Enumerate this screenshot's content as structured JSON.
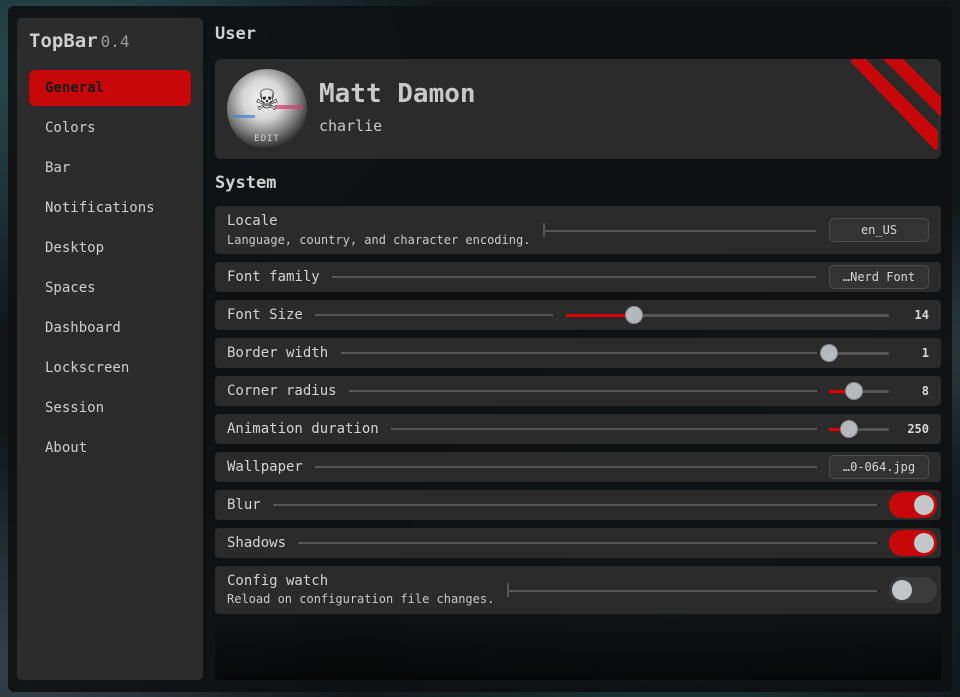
{
  "app": {
    "name": "TopBar",
    "version": "0.4"
  },
  "sidebar": {
    "items": [
      {
        "label": "General",
        "active": true
      },
      {
        "label": "Colors"
      },
      {
        "label": "Bar"
      },
      {
        "label": "Notifications"
      },
      {
        "label": "Desktop"
      },
      {
        "label": "Spaces"
      },
      {
        "label": "Dashboard"
      },
      {
        "label": "Lockscreen"
      },
      {
        "label": "Session"
      },
      {
        "label": "About"
      }
    ]
  },
  "user": {
    "section_title": "User",
    "name": "Matt Damon",
    "handle": "charlie",
    "avatar_edit_label": "EDIT",
    "avatar_icon": "skull-avatar-image"
  },
  "system": {
    "section_title": "System",
    "locale": {
      "label": "Locale",
      "description": "Language, country, and character encoding.",
      "value": "en_US"
    },
    "font_family": {
      "label": "Font family",
      "value": "…Nerd Font"
    },
    "font_size": {
      "label": "Font Size",
      "value": "14",
      "level": 0.21
    },
    "border_width": {
      "label": "Border width",
      "value": "1",
      "level": 0.0
    },
    "corner_radius": {
      "label": "Corner radius",
      "value": "8",
      "level": 0.42
    },
    "animation_duration": {
      "label": "Animation duration",
      "value": "250",
      "level": 0.33
    },
    "wallpaper": {
      "label": "Wallpaper",
      "value": "…0-064.jpg"
    },
    "blur": {
      "label": "Blur",
      "enabled": true
    },
    "shadows": {
      "label": "Shadows",
      "enabled": true
    },
    "config_watch": {
      "label": "Config watch",
      "description": "Reload on configuration file changes.",
      "enabled": false
    }
  },
  "colors": {
    "accent": "#c8070a",
    "panel": "#2b2b2b",
    "sidebar": "#2c2c2c"
  }
}
